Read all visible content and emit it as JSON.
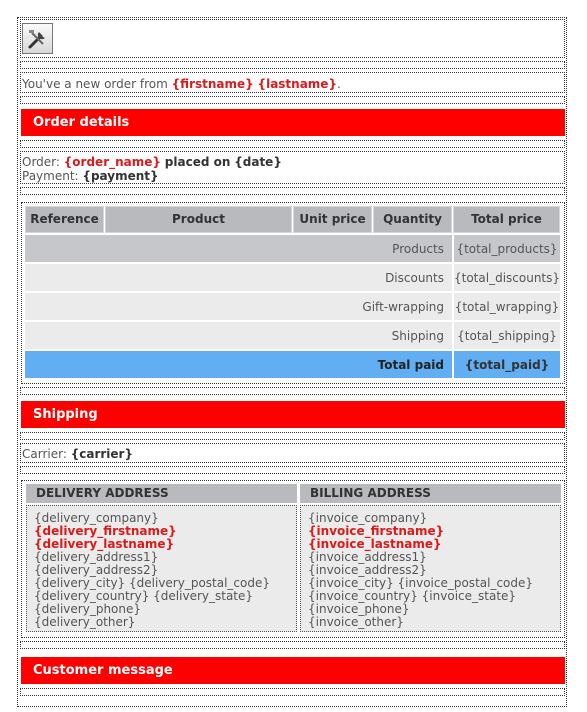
{
  "intro": {
    "prefix": "You've a new order from",
    "firstname": "{firstname}",
    "lastname": "{lastname}",
    "suffix": "."
  },
  "sections": {
    "order_details": "Order details",
    "shipping": "Shipping",
    "customer_message": "Customer message"
  },
  "order": {
    "order_label": "Order:",
    "order_name": "{order_name}",
    "placed_on": "placed on",
    "date": "{date}",
    "payment_label": "Payment:",
    "payment": "{payment}"
  },
  "table": {
    "headers": [
      "Reference",
      "Product",
      "Unit price",
      "Quantity",
      "Total price"
    ],
    "rows": [
      {
        "label": "Products",
        "value": "{total_products}"
      },
      {
        "label": "Discounts",
        "value": "{total_discounts}"
      },
      {
        "label": "Gift-wrapping",
        "value": "{total_wrapping}"
      },
      {
        "label": "Shipping",
        "value": "{total_shipping}"
      }
    ],
    "total": {
      "label": "Total paid",
      "value": "{total_paid}"
    }
  },
  "carrier": {
    "label": "Carrier:",
    "value": "{carrier}"
  },
  "delivery": {
    "heading": "DELIVERY ADDRESS",
    "lines": [
      "{delivery_company}",
      "{delivery_firstname}",
      "{delivery_lastname}",
      "{delivery_address1}",
      "{delivery_address2}",
      "{delivery_city} {delivery_postal_code}",
      "{delivery_country} {delivery_state}",
      "{delivery_phone}",
      "{delivery_other}"
    ]
  },
  "billing": {
    "heading": "BILLING ADDRESS",
    "lines": [
      "{invoice_company}",
      "{invoice_firstname}",
      "{invoice_lastname}",
      "{invoice_address1}",
      "{invoice_address2}",
      "{invoice_city} {invoice_postal_code}",
      "{invoice_country} {invoice_state}",
      "{invoice_phone}",
      "{invoice_other}"
    ]
  },
  "colors": {
    "section_bar": "#ff0000",
    "placeholder_red": "#db1b1b",
    "table_header": "#b9babe",
    "row_dark": "#c6c7cb",
    "row_light": "#ebebeb",
    "total_row": "#61aef2"
  },
  "icons": {
    "logo": "tools-icon"
  }
}
